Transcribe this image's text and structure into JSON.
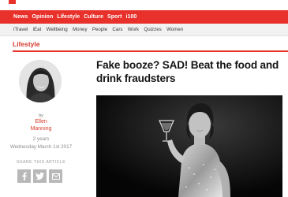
{
  "nav": {
    "primary": [
      {
        "label": "News"
      },
      {
        "label": "Opinion"
      },
      {
        "label": "Lifestyle"
      },
      {
        "label": "Culture"
      },
      {
        "label": "Sport"
      },
      {
        "label": "i100"
      }
    ],
    "secondary": [
      {
        "label": "iTravel"
      },
      {
        "label": "iEat"
      },
      {
        "label": "Wellbeing"
      },
      {
        "label": "Money"
      },
      {
        "label": "People"
      },
      {
        "label": "Cars"
      },
      {
        "label": "Work"
      },
      {
        "label": "Quizzes"
      },
      {
        "label": "Women"
      }
    ]
  },
  "section": {
    "label": "Lifestyle"
  },
  "author": {
    "by": "by",
    "name_line1": "Ellen",
    "name_line2": "Manning",
    "ago": "2 years",
    "date": "Wednesday March 1st 2017"
  },
  "share": {
    "label": "SHARE THIS ARTICLE",
    "buttons": [
      {
        "icon": "facebook-icon"
      },
      {
        "icon": "twitter-icon"
      },
      {
        "icon": "email-icon"
      }
    ]
  },
  "article": {
    "headline": "Fake booze? SAD! Beat the food and drink fraudsters"
  },
  "colors": {
    "brand_red": "#e8312b",
    "section_red": "#d73a2c",
    "nav_secondary_bg": "#f2f2f2"
  }
}
